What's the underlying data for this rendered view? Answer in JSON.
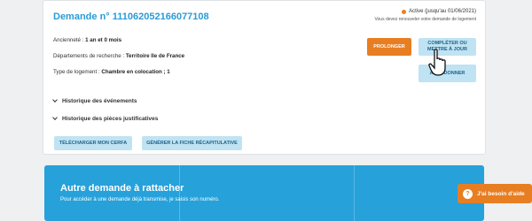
{
  "demande": {
    "title": "Demande n° 111062052166077108",
    "status": "Active (jusqu'au 01/06/2021)",
    "status_note": "Vous devez renouveler votre demande de logement",
    "fields": [
      {
        "label": "Ancienneté : ",
        "value": "1 an et 0 mois"
      },
      {
        "label": "Départements de recherche : ",
        "value": "Territoire Ile de France"
      },
      {
        "label": "Type de logement : ",
        "value": "Chambre en colocation ; 1"
      }
    ],
    "accordions": [
      "Historique des événements",
      "Historique des pièces justificatives"
    ],
    "buttons": {
      "prolonger": "PROLONGER",
      "completer": "COMPLÉTER OU METTRE À JOUR",
      "abandonner": "ABANDONNER",
      "cerfa": "TÉLÉCHARGER MON CERFA",
      "fiche": "GÉNÉRER LA FICHE RÉCAPITULATIVE"
    }
  },
  "banner": {
    "title": "Autre demande à rattacher",
    "subtitle": "Pour accéder à une demande déjà transmise, je saisis son numéro."
  },
  "help": {
    "label": "J'ai besoin d'aide"
  },
  "colors": {
    "accent": "#2a9bd6",
    "orange": "#e87e22",
    "banner": "#26a1da",
    "light_button": "#bfe3f2"
  }
}
